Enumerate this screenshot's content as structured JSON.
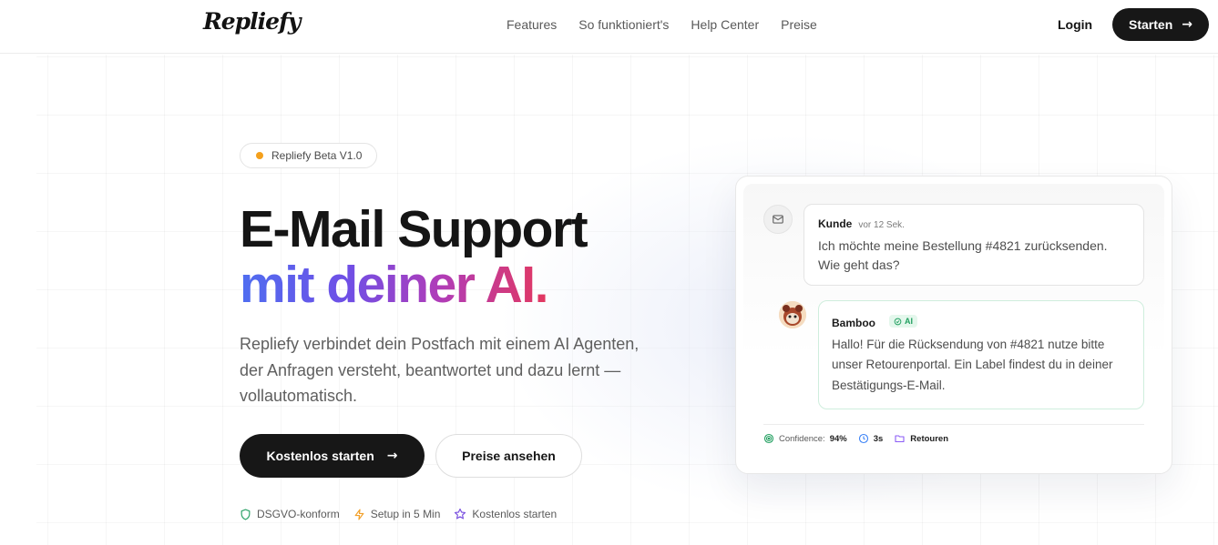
{
  "header": {
    "logo": "Repliefy",
    "nav": [
      "Features",
      "So funktioniert's",
      "Help Center",
      "Preise"
    ],
    "login": "Login",
    "start": "Starten"
  },
  "hero": {
    "badge": "Repliefy Beta V1.0",
    "title_line1": "E-Mail Support",
    "title_line2": "mit deiner AI.",
    "lead": "Repliefy verbindet dein Postfach mit einem AI Agenten, der Anfragen versteht, beantwortet und dazu lernt — vollautomatisch.",
    "cta_primary": "Kostenlos starten",
    "cta_secondary": "Preise ansehen",
    "features": [
      "DSGVO-konform",
      "Setup in 5 Min",
      "Kostenlos starten"
    ]
  },
  "demo": {
    "customer": {
      "name": "Kunde",
      "time": "vor 12 Sek.",
      "text": "Ich möchte meine Bestellung #4821 zurücksenden. Wie geht das?"
    },
    "agent": {
      "name": "Bamboo",
      "badge": "AI",
      "text": "Hallo! Für die Rücksendung von #4821 nutze bitte unser Retourenportal. Ein Label findest du in deiner Bestätigungs-E-Mail."
    },
    "stats": {
      "confidence_label": "Confidence:",
      "confidence_value": "94%",
      "time": "3s",
      "category": "Retouren"
    }
  },
  "colors": {
    "accent_dark": "#171717",
    "badge_dot": "#f4a01c",
    "ai_green": "#23a061",
    "gradient_start": "#4f6ef0",
    "gradient_end": "#e3385f"
  },
  "icons": [
    "arrow-right-icon",
    "shield-icon",
    "bolt-icon",
    "star-icon",
    "mail-icon",
    "check-circle-icon",
    "target-icon",
    "clock-icon",
    "folder-icon"
  ]
}
